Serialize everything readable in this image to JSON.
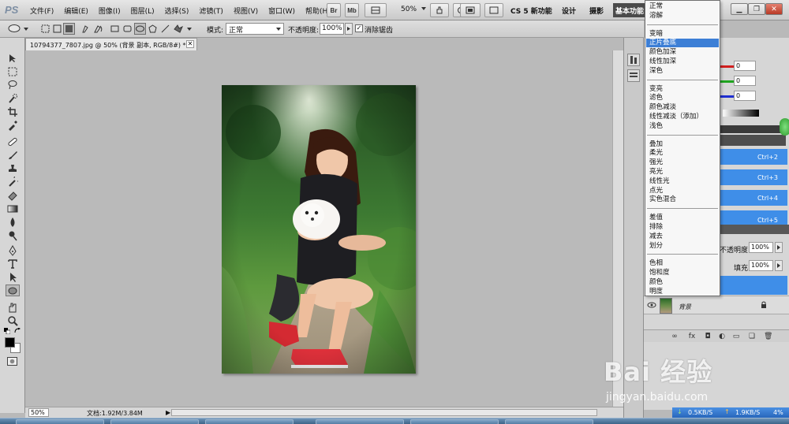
{
  "app": {
    "logo": "PS"
  },
  "menubar": {
    "menus": [
      "文件(F)",
      "编辑(E)",
      "图像(I)",
      "图层(L)",
      "选择(S)",
      "滤镜(T)",
      "视图(V)",
      "窗口(W)",
      "帮助(H)"
    ],
    "bridge_label": "Br",
    "minibridge_label": "Mb",
    "zoom_value": "50%",
    "workspaces": {
      "cs5_new": "CS 5 新功能",
      "design": "设计",
      "photography": "摄影",
      "basic": "基本功能"
    }
  },
  "options_bar": {
    "mode_label": "模式:",
    "mode_value": "正常",
    "opacity_label": "不透明度:",
    "opacity_value": "100%",
    "antialias_checked": true,
    "antialias_label": "消除锯齿"
  },
  "document": {
    "tab_title": "10794377_7807.jpg @ 50% (背景 副本, RGB/8#) *",
    "close_glyph": "✕",
    "zoom_field": "50%",
    "doc_info": "文档:1.92M/3.84M"
  },
  "blend_menu": {
    "groups": [
      [
        {
          "label": "正常"
        },
        {
          "label": "溶解"
        }
      ],
      [
        {
          "label": "变暗"
        },
        {
          "label": "正片叠底",
          "selected": true
        },
        {
          "label": "颜色加深"
        },
        {
          "label": "线性加深"
        },
        {
          "label": "深色"
        }
      ],
      [
        {
          "label": "变亮"
        },
        {
          "label": "滤色"
        },
        {
          "label": "颜色减淡"
        },
        {
          "label": "线性减淡（添加）"
        },
        {
          "label": "浅色"
        }
      ],
      [
        {
          "label": "叠加"
        },
        {
          "label": "柔光"
        },
        {
          "label": "强光"
        },
        {
          "label": "亮光"
        },
        {
          "label": "线性光"
        },
        {
          "label": "点光"
        },
        {
          "label": "实色混合"
        }
      ],
      [
        {
          "label": "差值"
        },
        {
          "label": "排除"
        },
        {
          "label": "减去"
        },
        {
          "label": "划分"
        }
      ],
      [
        {
          "label": "色相"
        },
        {
          "label": "饱和度"
        },
        {
          "label": "颜色"
        },
        {
          "label": "明度"
        }
      ]
    ]
  },
  "color_panel": {
    "r": "0",
    "g": "0",
    "b": "0",
    "colors": {
      "r": "#d21f1f",
      "g": "#1fa51f",
      "b": "#1f2fd2"
    }
  },
  "channels_panel": {
    "shortcuts": [
      "Ctrl+2",
      "Ctrl+3",
      "Ctrl+4",
      "Ctrl+5"
    ]
  },
  "layers_panel": {
    "opacity_label": "不透明度:",
    "opacity_value": "100%",
    "fill_label": "填充:",
    "fill_value": "100%",
    "background_layer_name": "背景",
    "footer_icons": [
      "link-icon",
      "fx-icon",
      "mask-icon",
      "adjustment-icon",
      "folder-icon",
      "new-layer-icon",
      "trash-icon"
    ]
  },
  "watermark": {
    "logo": "Bai  经验",
    "url": "jingyan.baidu.com"
  },
  "net_widget": {
    "down": "0.5KB/S",
    "up": "1.9KB/S",
    "cpu": "4%"
  },
  "accent": "#3d7fd6"
}
